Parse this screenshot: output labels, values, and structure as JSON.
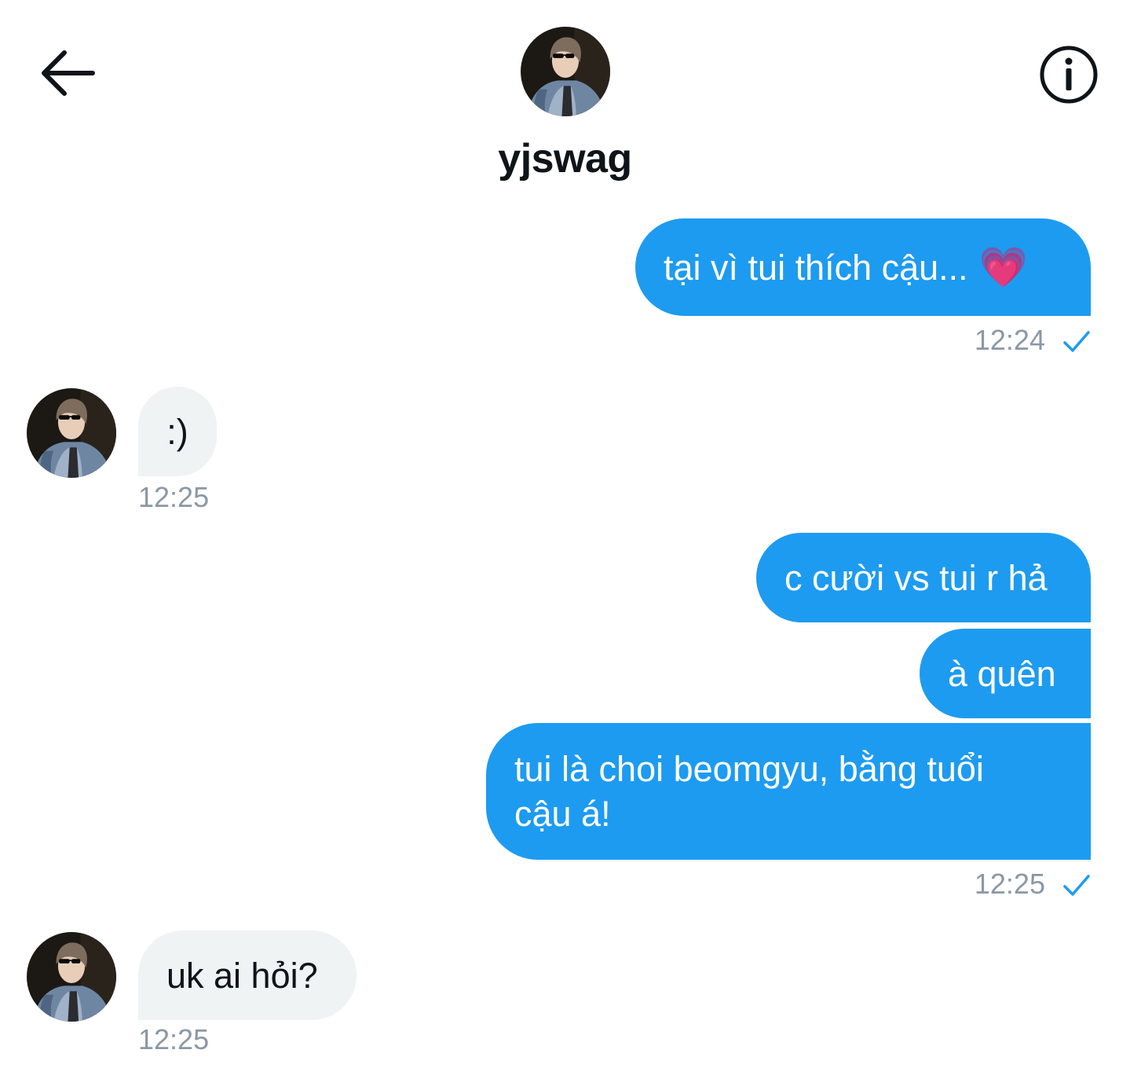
{
  "header": {
    "back_icon": "arrow-left-icon",
    "info_icon": "info-icon",
    "contact_name": "yjswag"
  },
  "messages": [
    {
      "side": "sent",
      "text": "tại vì tui thích cậu...",
      "emoji": "💗"
    },
    {
      "side": "sent_time",
      "time": "12:24"
    },
    {
      "side": "received",
      "text": ":)",
      "time": "12:25"
    },
    {
      "side": "sent",
      "text": "c cười vs tui r hả"
    },
    {
      "side": "sent",
      "text": "à quên"
    },
    {
      "side": "sent",
      "text": "tui là choi beomgyu, bằng tuổi cậu á!"
    },
    {
      "side": "sent_time",
      "time": "12:25"
    },
    {
      "side": "received",
      "text": "uk ai hỏi?",
      "time": "12:25"
    }
  ],
  "colors": {
    "sent_bubble": "#1d9bf0",
    "received_bubble": "#eff3f4",
    "timestamp": "#8b98a5",
    "read_check": "#1d9bf0"
  }
}
